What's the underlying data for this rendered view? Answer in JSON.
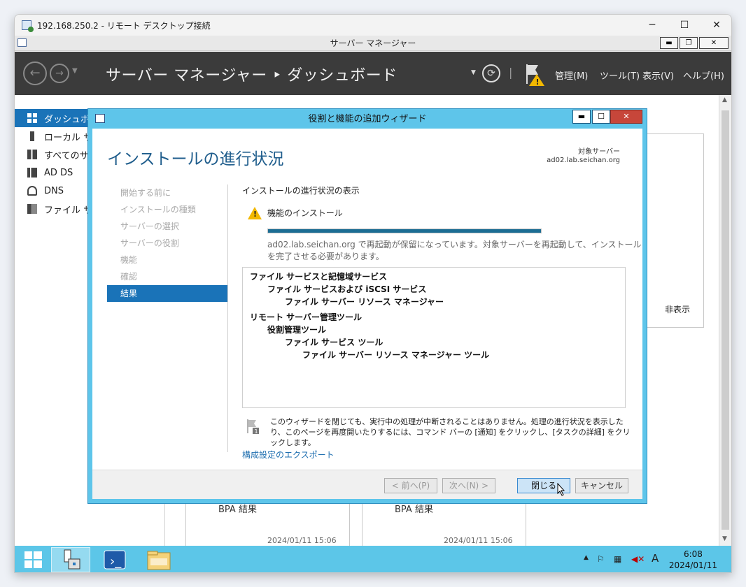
{
  "rdp": {
    "title": "192.168.250.2 - リモート デスクトップ接続",
    "min": "─",
    "max": "☐",
    "close": "✕"
  },
  "server_manager": {
    "window_title": "サーバー マネージャー",
    "breadcrumb": "サーバー マネージャー ‣ ダッシュボード",
    "menus": [
      "管理(M)",
      "ツール(T)",
      "表示(V)",
      "ヘルプ(H)"
    ],
    "sidebar": [
      "ダッシュボー",
      "ローカル サ",
      "すべてのサ",
      "AD DS",
      "DNS",
      "ファイル サ"
    ],
    "hide_label": "非表示",
    "bpa_cards": [
      {
        "label": "BPA 結果",
        "timestamp": "2024/01/11 15:06"
      },
      {
        "label": "BPA 結果",
        "timestamp": "2024/01/11 15:06"
      }
    ]
  },
  "wizard": {
    "title": "役割と機能の追加ウィザード",
    "heading": "インストールの進行状況",
    "target_label": "対象サーバー",
    "target_server": "ad02.lab.seichan.org",
    "steps": [
      "開始する前に",
      "インストールの種類",
      "サーバーの選択",
      "サーバーの役割",
      "機能",
      "確認",
      "結果"
    ],
    "active_step": 6,
    "progress_title": "インストールの進行状況の表示",
    "status": "機能のインストール",
    "progress": 1.0,
    "restart_message": "ad02.lab.seichan.org で再起動が保留になっています。対象サーバーを再起動して、インストールを完了させる必要があります。",
    "features": [
      {
        "text": "ファイル サービスと記憶域サービス",
        "level": 0
      },
      {
        "text": "ファイル サービスおよび iSCSI サービス",
        "level": 1
      },
      {
        "text": "ファイル サーバー リソース マネージャー",
        "level": 2
      },
      {
        "text": "リモート サーバー管理ツール",
        "level": 0
      },
      {
        "text": "役割管理ツール",
        "level": 1
      },
      {
        "text": "ファイル サービス ツール",
        "level": 2
      },
      {
        "text": "ファイル サーバー リソース マネージャー ツール",
        "level": 3
      }
    ],
    "note": "このウィザードを閉じても、実行中の処理が中断されることはありません。処理の進行状況を表示したり、このページを再度開いたりするには、コマンド バーの [通知] をクリックし、[タスクの詳細] をクリックします。",
    "export_link": "構成設定のエクスポート",
    "buttons": {
      "prev": "< 前へ(P)",
      "next": "次へ(N) >",
      "close": "閉じる",
      "cancel": "キャンセル"
    }
  },
  "taskbar": {
    "time": "6:08",
    "date": "2024/01/11",
    "ime": "A"
  },
  "colors": {
    "accent": "#1a73b8",
    "wizard_frame": "#5ec5ea",
    "header": "#3b3b3b",
    "taskbar": "#5cc6e8",
    "progress": "#1c6d93"
  }
}
